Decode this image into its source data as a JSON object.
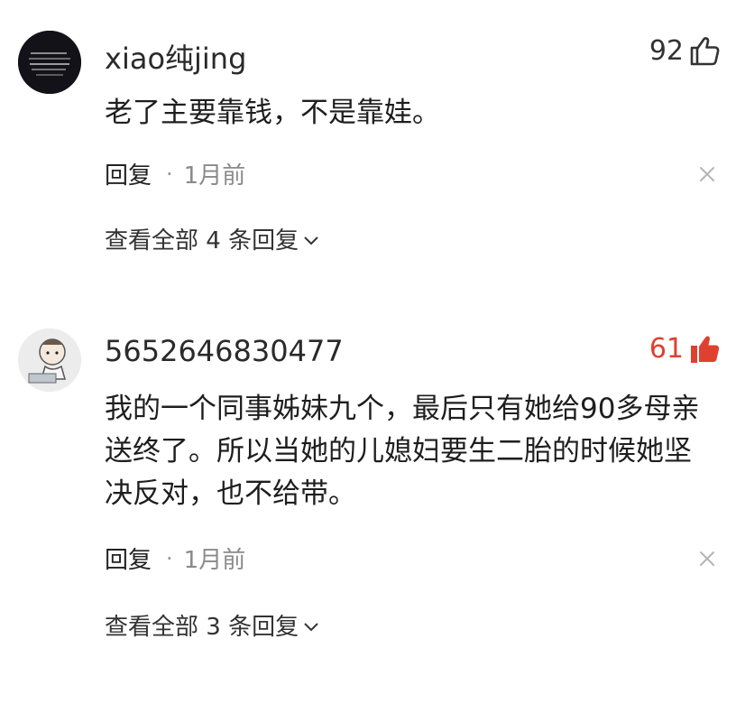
{
  "comments": [
    {
      "username": "xiao纯jing",
      "likes": "92",
      "liked": false,
      "text_lines": [
        "老了主要靠钱，不是靠娃。"
      ],
      "reply_label": "回复",
      "separator": "·",
      "time": "1月前",
      "view_replies": "查看全部 4 条回复"
    },
    {
      "username": "5652646830477",
      "likes": "61",
      "liked": true,
      "text_lines": [
        "我的一个同事姊妹九个，最后只有她给90多母亲",
        "送终了。所以当她的儿媳妇要生二胎的时候她坚",
        "决反对，也不给带。"
      ],
      "reply_label": "回复",
      "separator": "·",
      "time": "1月前",
      "view_replies": "查看全部 3 条回复"
    }
  ],
  "colors": {
    "liked": "#e0402f",
    "muted": "#8a8a8a"
  }
}
